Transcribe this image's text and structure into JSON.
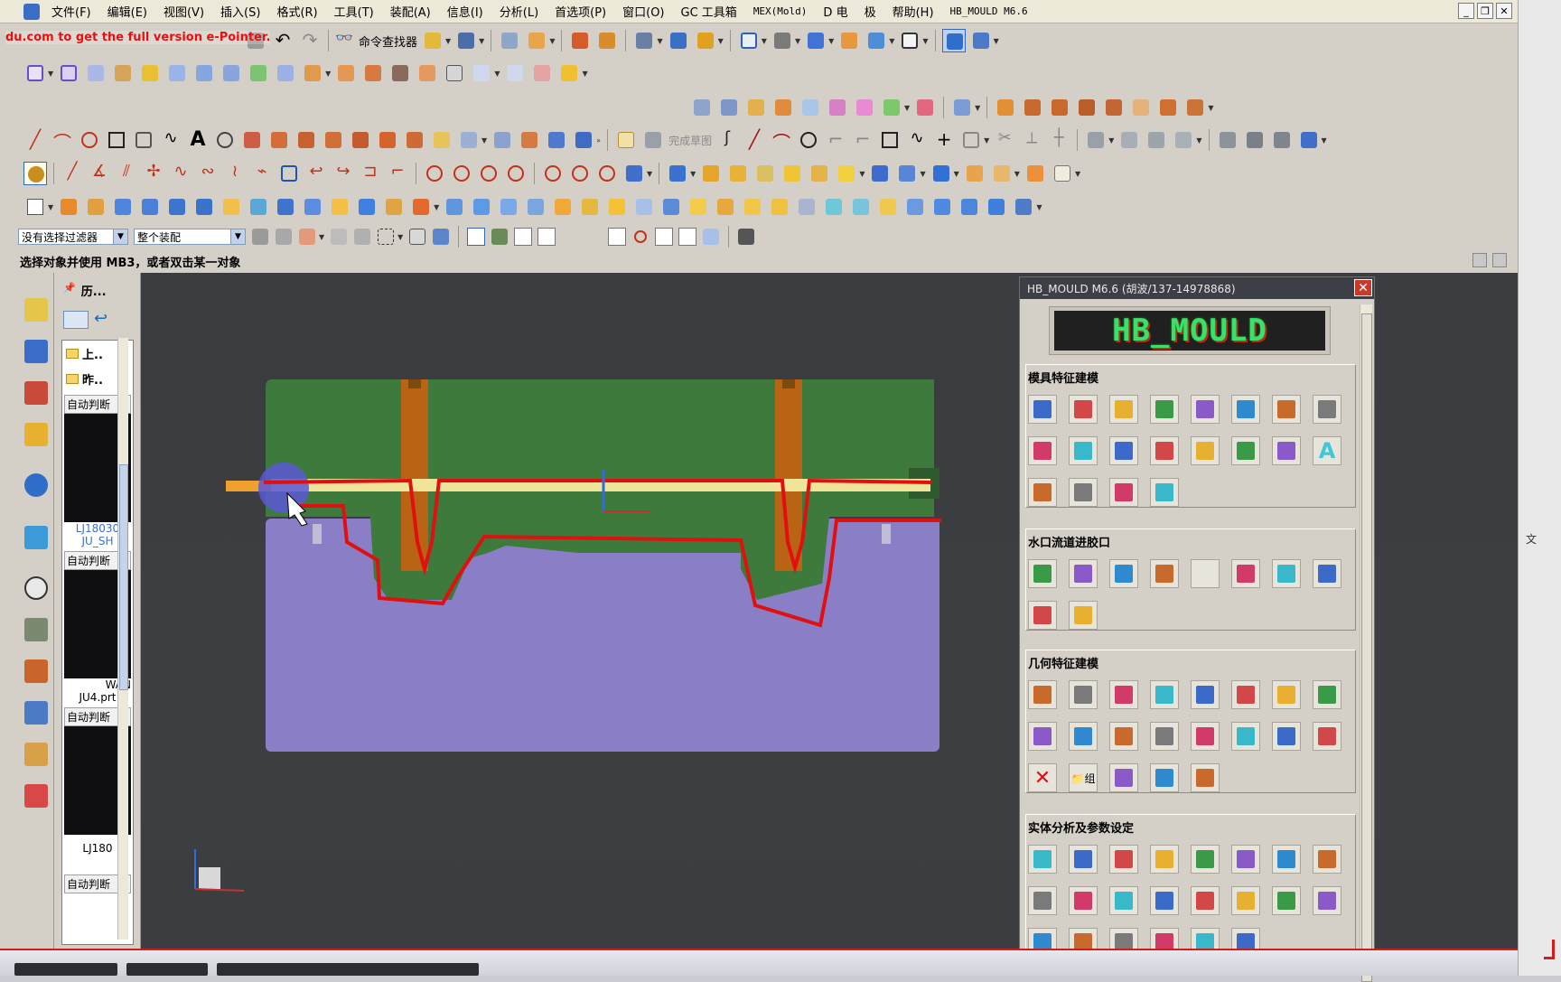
{
  "menu": {
    "items": [
      "文件(F)",
      "编辑(E)",
      "视图(V)",
      "插入(S)",
      "格式(R)",
      "工具(T)",
      "装配(A)",
      "信息(I)",
      "分析(L)",
      "首选项(P)",
      "窗口(O)",
      "GC 工具箱",
      "MEX(Mold)",
      "D 电",
      "极",
      "帮助(H)",
      "HB_MOULD M6.6"
    ]
  },
  "toolbar": {
    "command_finder": "命令查找器",
    "finish_sketch": "完成草图"
  },
  "watermark": "du.com to get the full version e-Pointer.",
  "selection_bar": {
    "filter_value": "没有选择过滤器",
    "scope_value": "整个装配"
  },
  "status": {
    "prompt": "选择对象并使用 MB3，或者双击某一对象"
  },
  "nav": {
    "title": "历...",
    "nodes": [
      "上..",
      "昨.."
    ],
    "cards": [
      {
        "label": "自动判断",
        "caption_1": "LJ18030",
        "caption_2": "JU_SH"
      },
      {
        "label": "自动判断",
        "caption_1": "WAN",
        "caption_2": "JU4.prt"
      },
      {
        "label": "自动判断",
        "caption_1": "LJ180",
        "caption_2": ""
      },
      {
        "label": "自动判断",
        "caption_1": "",
        "caption_2": ""
      }
    ]
  },
  "dialog": {
    "title": "HB_MOULD M6.6 (胡波/137-14978868)",
    "logo": "HB_MOULD",
    "groups": [
      {
        "title": "模具特征建模",
        "icons": [
          "frame-icon",
          "plate-icon",
          "slider-icon",
          "pattern-icon",
          "diamond-icon",
          "split-icon",
          "layer-icon",
          "layer-active-icon",
          "corner-icon",
          "pin-icon",
          "ejector-icon",
          "bar-icon",
          "rod-icon",
          "post-icon",
          "red-post-icon",
          "text-a-icon",
          "cup-icon",
          "grid-icon",
          "column-icon",
          "stack-icon"
        ]
      },
      {
        "title": "水口流道进胶口",
        "icons": [
          "nozzle-icon",
          "runner-icon",
          "gate-icon",
          "edge-gate-icon",
          "circle-icon",
          "bowl-icon",
          "bowl2-icon",
          "curve-icon",
          "sprue-icon",
          "taper-icon"
        ]
      },
      {
        "title": "几何特征建模",
        "icons": [
          "red-cube-icon",
          "green-diamond-icon",
          "box-icon",
          "resize-icon",
          "gift-icon",
          "color-grid-icon",
          "crosshair-box-icon",
          "line-icon",
          "target-icon",
          "parallel-lines-icon",
          "center-point-icon",
          "color-layers-icon",
          "cube-edit-icon",
          "angle-icon",
          "rotate-box-icon",
          "measure-box-icon",
          "delete-icon",
          "group-icon",
          "bell-icon",
          "copy-icon",
          "cloud-icon"
        ]
      },
      {
        "title": "实体分析及参数设定",
        "icons": [
          "analyze-icon",
          "diamond-grid-icon",
          "ruler-icon",
          "align-icon",
          "radius-icon",
          "plane-icon",
          "angle-ruler-icon",
          "text-box-icon",
          "table-icon",
          "formula-icon",
          "coin-icon",
          "triangle-icon",
          "coin2-icon",
          "bracket-m-icon",
          "calculator-icon",
          "list-icon",
          "lines-icon",
          "boxes-icon",
          "angle2-icon",
          "clock-icon",
          "speaker-icon",
          "hourglass-icon"
        ]
      }
    ],
    "group_labels": {
      "group_icon_text": "组"
    }
  },
  "colors": {
    "viewport_bg": "#3b3d41",
    "core_purple": "#8a7fc6",
    "cavity_green": "#3e7a3c",
    "runner_orange": "#c86e14",
    "runner_yellow": "#f0e49a",
    "sketch_red": "#e01010"
  }
}
